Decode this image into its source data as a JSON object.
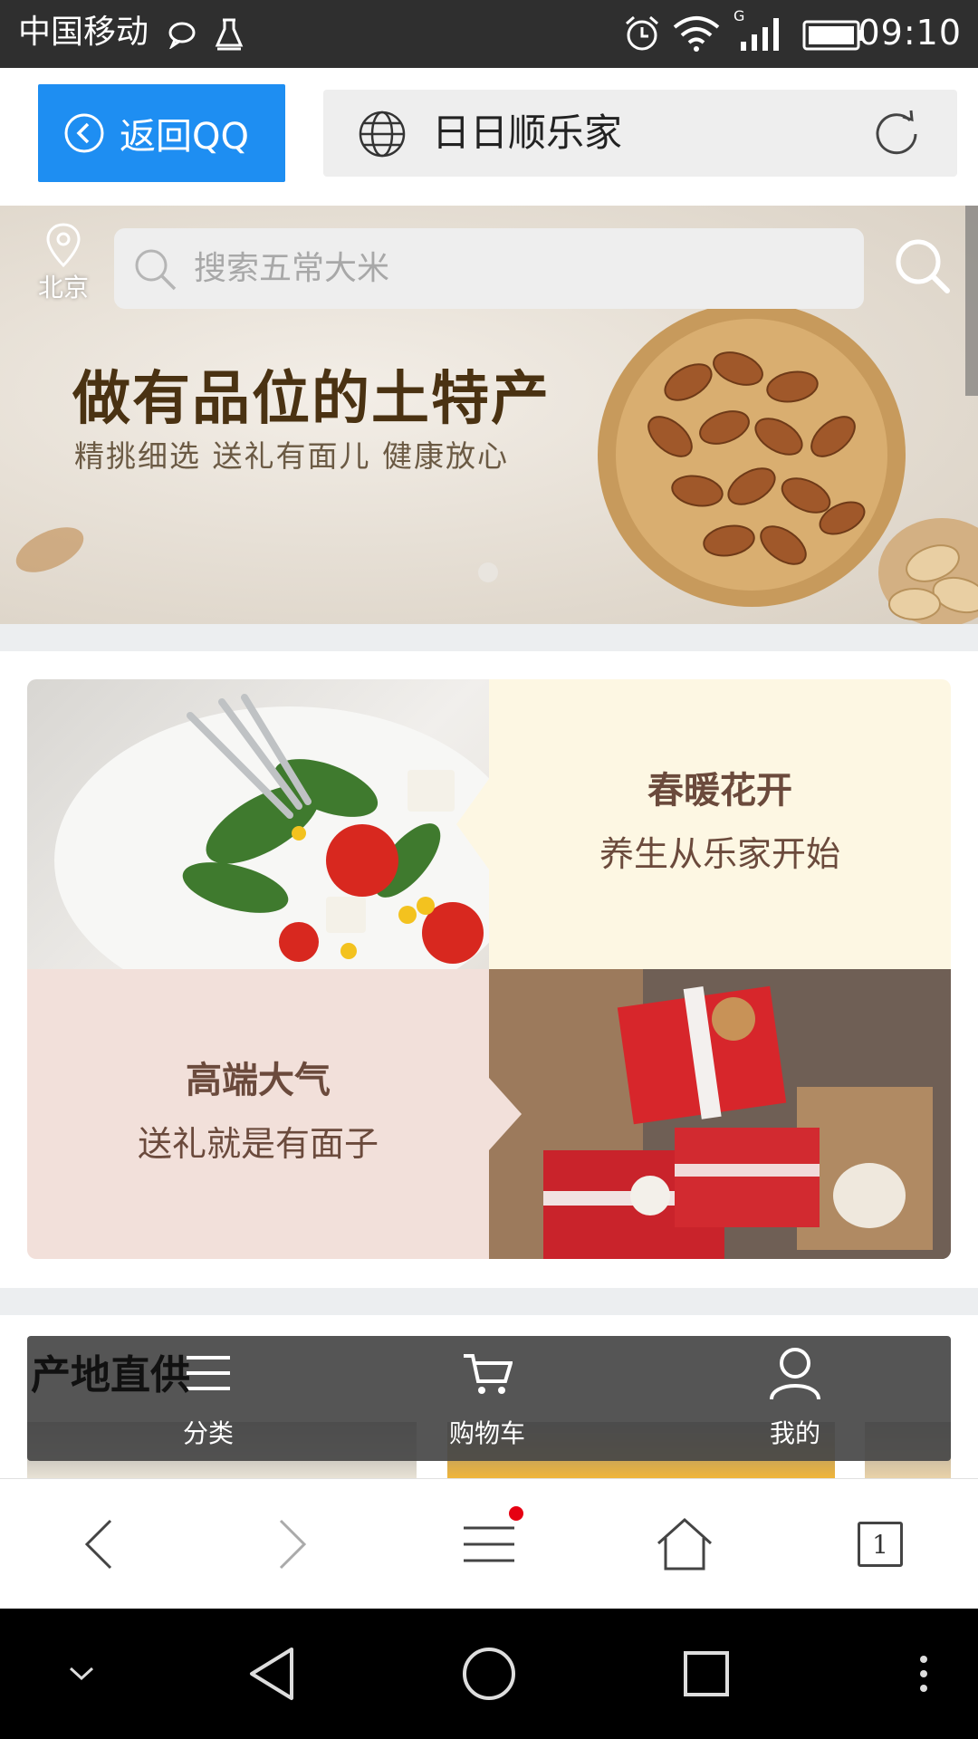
{
  "status_bar": {
    "carrier": "中国移动",
    "time": "09:10",
    "network": "G"
  },
  "browser_header": {
    "back_label": "返回QQ",
    "site_title": "日日顺乐家"
  },
  "banner": {
    "location": "北京",
    "search_placeholder": "搜索五常大米",
    "title": "做有品位的土特产",
    "subtitle": "精挑细选 送礼有面儿 健康放心"
  },
  "promos": [
    {
      "headline": "春暖花开",
      "subtext": "养生从乐家开始"
    },
    {
      "headline": "高端大气",
      "subtext": "送礼就是有面子"
    }
  ],
  "section": {
    "title": "产地直供"
  },
  "bottom_tabs": [
    {
      "label": "分类",
      "icon": "menu-icon"
    },
    {
      "label": "购物车",
      "icon": "cart-icon"
    },
    {
      "label": "我的",
      "icon": "user-icon"
    }
  ],
  "browser_toolbar": {
    "tab_count": "1"
  },
  "colors": {
    "accent_blue": "#1e8ef2",
    "status_bar": "#2f2f2f",
    "promo_text": "#6b4a3c",
    "badge_red": "#e60012"
  }
}
